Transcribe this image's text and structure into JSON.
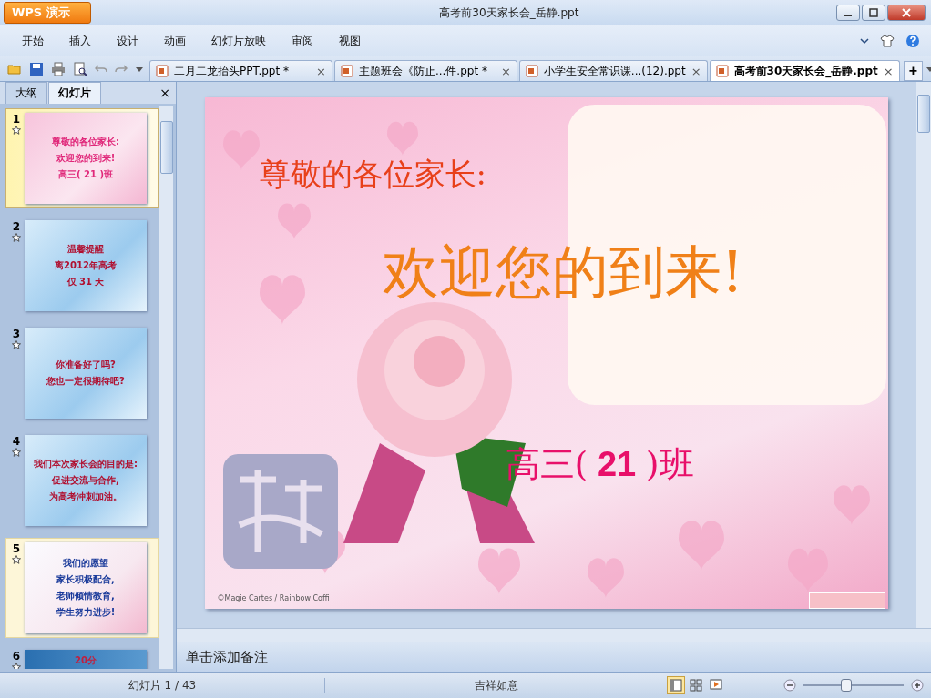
{
  "app_button": {
    "label": "WPS 演示"
  },
  "window": {
    "title": "高考前30天家长会_岳静.ppt"
  },
  "menu": [
    {
      "label": "开始"
    },
    {
      "label": "插入"
    },
    {
      "label": "设计"
    },
    {
      "label": "动画"
    },
    {
      "label": "幻灯片放映"
    },
    {
      "label": "审阅"
    },
    {
      "label": "视图"
    }
  ],
  "doc_tabs": [
    {
      "label": "二月二龙抬头PPT.ppt *",
      "close": "×",
      "selected": false
    },
    {
      "label": "主题班会《防止...件.ppt *",
      "close": "×",
      "selected": false
    },
    {
      "label": "小学生安全常识课...(12).ppt",
      "close": "×",
      "selected": false
    },
    {
      "label": "高考前30天家长会_岳静.ppt",
      "close": "×",
      "selected": true
    }
  ],
  "new_tab": "+",
  "panel": {
    "tabs": [
      {
        "label": "大纲",
        "selected": false
      },
      {
        "label": "幻灯片",
        "selected": true
      }
    ],
    "close": "×"
  },
  "thumbnails": [
    {
      "number": "1",
      "kind": "pink",
      "selected": true,
      "highlighted": false,
      "lines": [
        "尊敬的各位家长:",
        "欢迎您的到来!",
        "高三( 21 )班"
      ]
    },
    {
      "number": "2",
      "kind": "blue",
      "selected": false,
      "highlighted": false,
      "lines": [
        "温馨提醒",
        "离2012年高考",
        "仅 31 天"
      ]
    },
    {
      "number": "3",
      "kind": "blue",
      "selected": false,
      "highlighted": false,
      "lines": [
        "你准备好了吗?",
        "您也一定很期待吧?"
      ]
    },
    {
      "number": "4",
      "kind": "blue",
      "selected": false,
      "highlighted": false,
      "lines": [
        "我们本次家长会的目的是:",
        "促进交流与合作,",
        "为高考冲刺加油。"
      ]
    },
    {
      "number": "5",
      "kind": "flower",
      "selected": false,
      "highlighted": true,
      "lines": [
        "我们的愿望",
        "家长积极配合,",
        "老师倾情教育,",
        "学生努力进步!"
      ]
    },
    {
      "number": "6",
      "kind": "dark",
      "selected": false,
      "highlighted": false,
      "lines": [
        "20分"
      ]
    }
  ],
  "slide": {
    "greeting": "尊敬的各位家长:",
    "welcome": "欢迎您的到来!",
    "class_prefix": "高三(",
    "class_number": " 21  ",
    "class_suffix": ")班",
    "credit": "©Magie Cartes / Rainbow Coffi"
  },
  "notes": {
    "placeholder": "单击添加备注"
  },
  "status_bar": {
    "slide_count": "幻灯片 1 / 43",
    "theme": "吉祥如意",
    "views": [
      {
        "kind": "normal",
        "selected": true
      },
      {
        "kind": "sorter",
        "selected": false
      },
      {
        "kind": "show",
        "selected": false
      }
    ],
    "zoom": {
      "level": 0.42
    }
  }
}
